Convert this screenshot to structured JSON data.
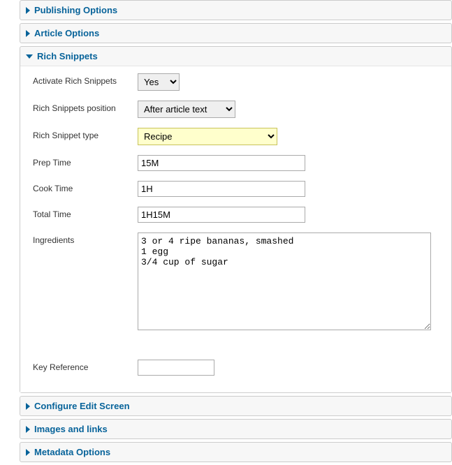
{
  "panels": {
    "publishing": {
      "title": "Publishing Options"
    },
    "article": {
      "title": "Article Options"
    },
    "rich_snippets": {
      "title": "Rich Snippets"
    },
    "configure": {
      "title": "Configure Edit Screen"
    },
    "images": {
      "title": "Images and links"
    },
    "metadata": {
      "title": "Metadata Options"
    }
  },
  "form": {
    "activate": {
      "label": "Activate Rich Snippets",
      "value": "Yes"
    },
    "position": {
      "label": "Rich Snippets position",
      "value": "After article text"
    },
    "type": {
      "label": "Rich Snippet type",
      "value": "Recipe"
    },
    "prep": {
      "label": "Prep Time",
      "value": "15M"
    },
    "cook": {
      "label": "Cook Time",
      "value": "1H"
    },
    "total": {
      "label": "Total Time",
      "value": "1H15M"
    },
    "ingredients": {
      "label": "Ingredients",
      "value": "3 or 4 ripe bananas, smashed\n1 egg\n3/4 cup of sugar"
    },
    "key_reference": {
      "label": "Key Reference",
      "value": ""
    }
  }
}
